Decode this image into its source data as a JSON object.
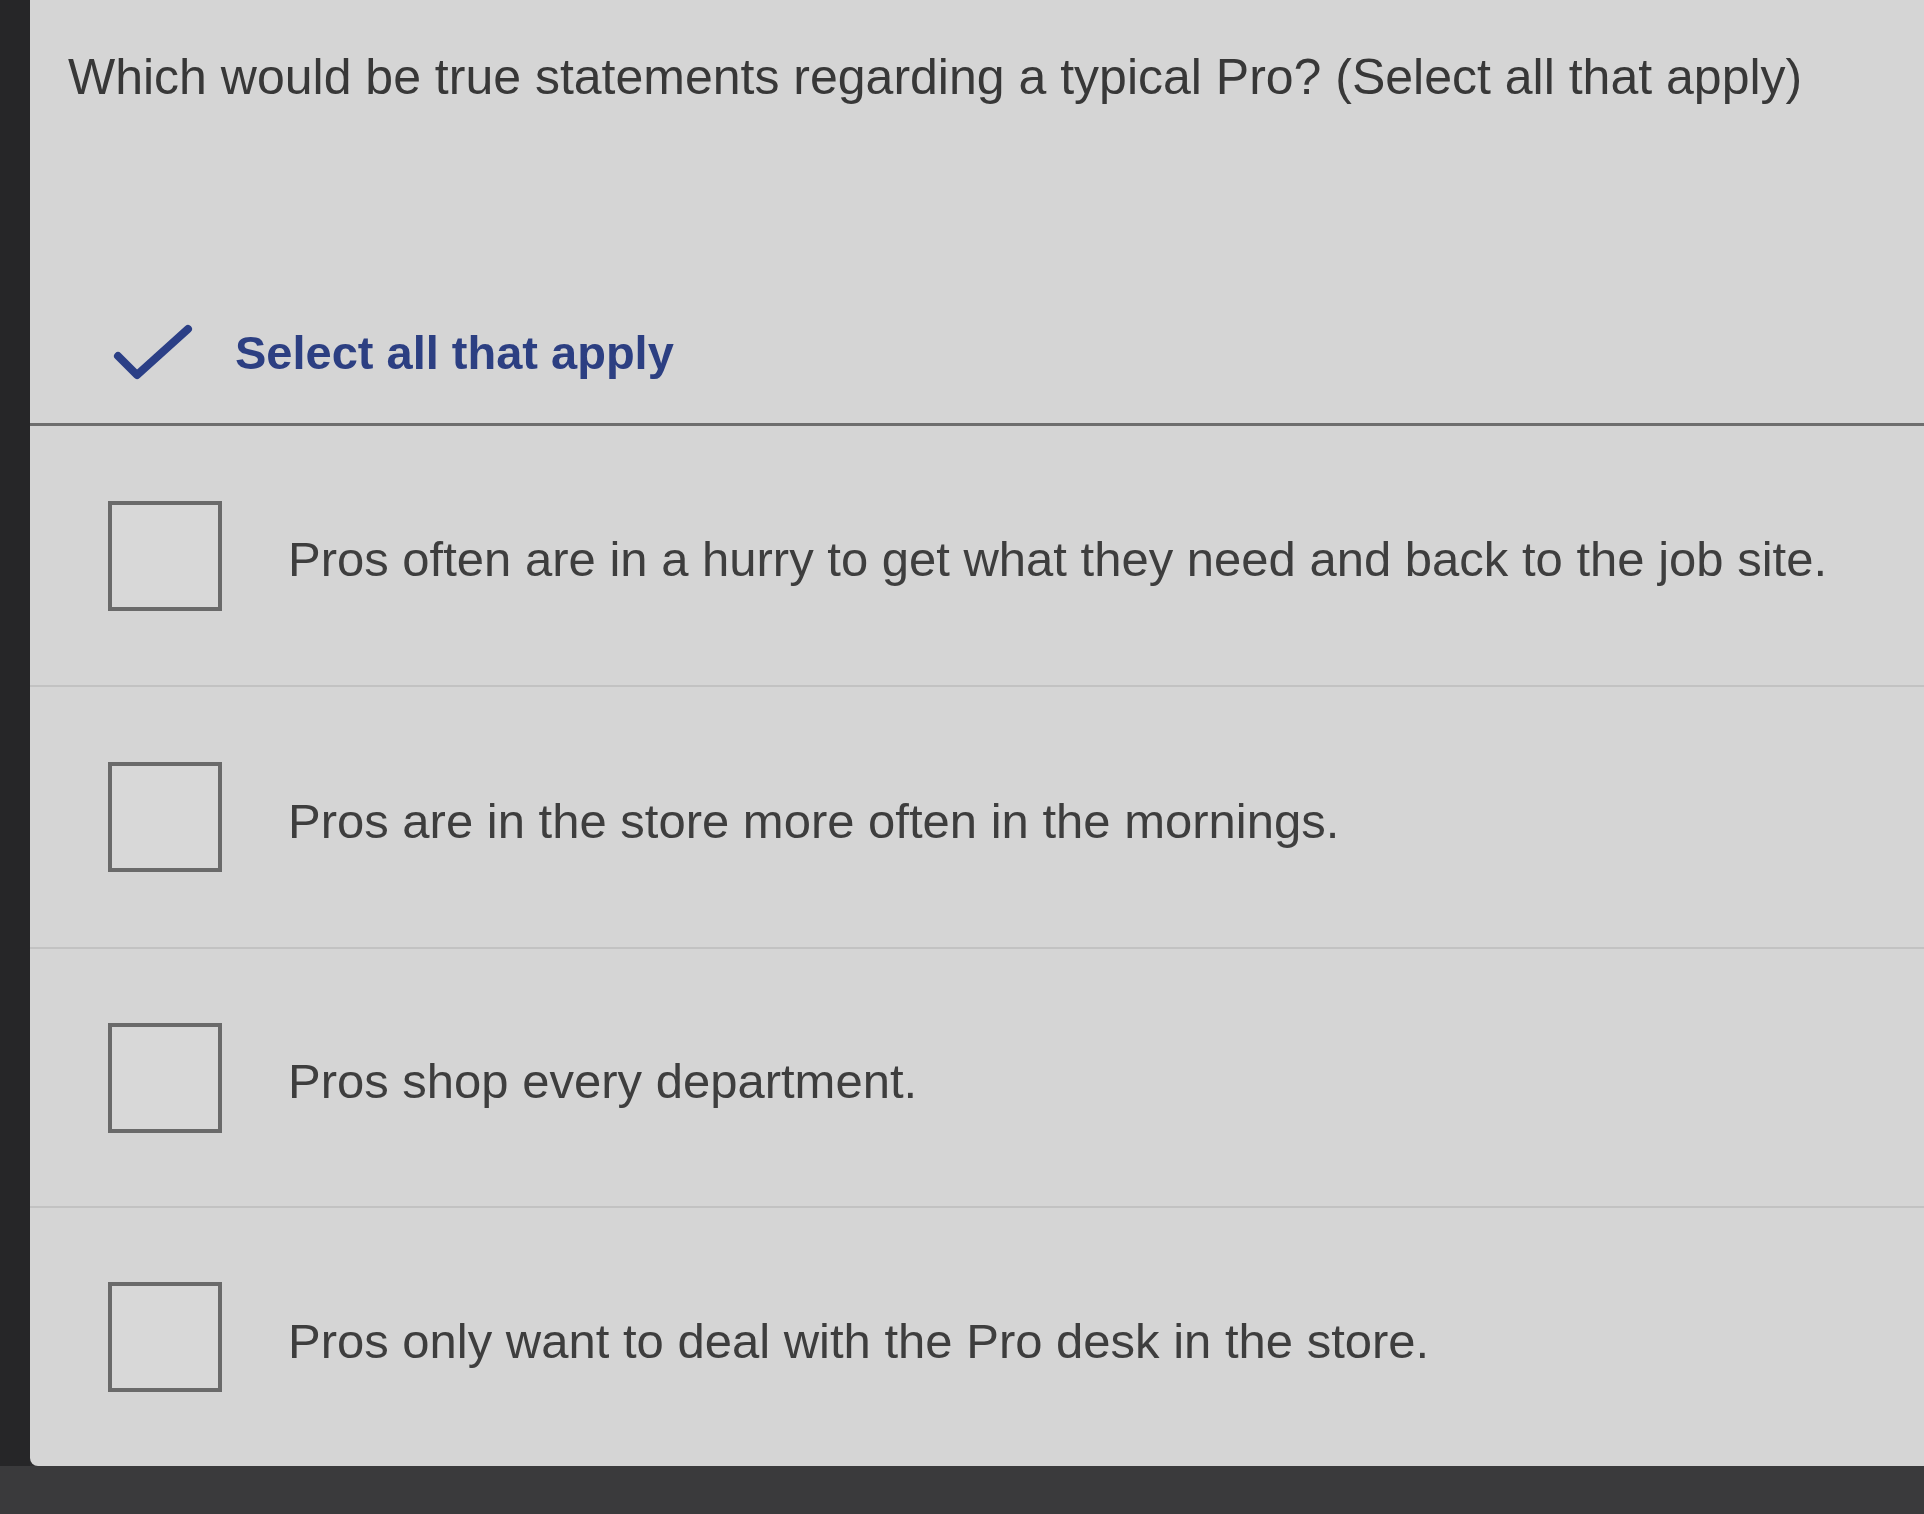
{
  "question": "Which would be true statements regarding a typical Pro? (Select all that apply)",
  "instruction": {
    "label": "Select all that apply"
  },
  "options": [
    {
      "label": "Pros often are in a hurry to get what they need and back to the job site.",
      "checked": false
    },
    {
      "label": "Pros are in the store more often in the mornings.",
      "checked": false
    },
    {
      "label": "Pros shop every department.",
      "checked": false
    },
    {
      "label": "Pros only want to deal with the Pro desk in the store.",
      "checked": false
    }
  ]
}
